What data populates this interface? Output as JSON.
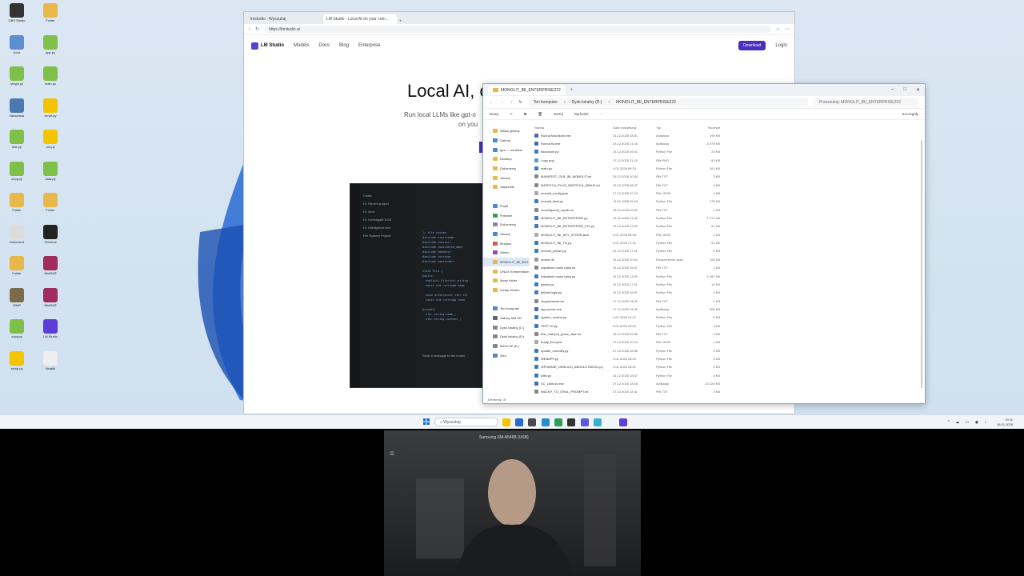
{
  "desktop": {
    "icons": [
      {
        "label": "OBS Studio",
        "color": "#333333"
      },
      {
        "label": "Folder",
        "color": "#e8b84a"
      },
      {
        "label": "Kosz",
        "color": "#5c8fd0"
      },
      {
        "label": "app.py",
        "color": "#7fc04a"
      },
      {
        "label": "skrypt.py",
        "color": "#7fc04a"
      },
      {
        "label": "main.py",
        "color": "#7fc04a"
      },
      {
        "label": "Narzędzia",
        "color": "#4a7ab0"
      },
      {
        "label": "script.py",
        "color": "#f4c400"
      },
      {
        "label": "test.py",
        "color": "#7fc04a"
      },
      {
        "label": "run.py",
        "color": "#f4c400"
      },
      {
        "label": "copy.py",
        "color": "#7fc04a"
      },
      {
        "label": "data.py",
        "color": "#7fc04a"
      },
      {
        "label": "Folder",
        "color": "#e8b84a"
      },
      {
        "label": "Folder",
        "color": "#e8b84a"
      },
      {
        "label": "Dokument",
        "color": "#dddddd"
      },
      {
        "label": "Terminal",
        "color": "#222222"
      },
      {
        "label": "Folder",
        "color": "#e8b84a"
      },
      {
        "label": "WinRAR",
        "color": "#a02c5c"
      },
      {
        "label": "GIMP",
        "color": "#7a6a4a"
      },
      {
        "label": "WinRAR",
        "color": "#a02c5c"
      },
      {
        "label": "copy.py",
        "color": "#7fc04a"
      },
      {
        "label": "LM Studio",
        "color": "#5b3fd6"
      },
      {
        "label": "setup.py",
        "color": "#f4c400"
      },
      {
        "label": "Notatki",
        "color": "#eeeeee"
      }
    ]
  },
  "browser": {
    "tabs": [
      "lmstudio - Wyszukaj",
      "LM Studio - Local AI on your com..."
    ],
    "url": "https://lmstudio.ai",
    "nav": {
      "brand": "LM Studio",
      "links": [
        "Models",
        "Docs",
        "Blog",
        "Enterprise"
      ],
      "download": "Download",
      "login": "Login"
    },
    "hero": {
      "title": "Local AI, o",
      "subtitle": "Run local LLMs like gpt-o",
      "subtitle2": "on you"
    }
  },
  "lmapp": {
    "items": [
      "Chats",
      "Dr. Recent project",
      "Dr. Aero",
      "Dr. Investigate DOS",
      "Dr. Intelligence test",
      "File System Project"
    ],
    "code": "// file system\n#include <iostream>\n#include <vector>\n#include <unordered_map>\n#include <memory>\n#include <string>\n#include <optional>\n\nclass File {\npublic:\n  explicit File(std::string\n  const std::string& name\n\n  void write(const std::str\n  const std::string& read\n\nprivate:\n  std::string name_;\n  std::string content_;",
    "prompt": "Send a message to the model..."
  },
  "explorer": {
    "tab_title": "MONOLIT_IBI_ENTERPRISE222",
    "breadcrumbs": [
      "Ten komputer",
      "Dysk lokalny (D:)",
      "MONOLIT_IBI_ENTERPRISE222"
    ],
    "search_placeholder": "Przeszukaj: MONOLIT_IBI_ENTERPRISE222",
    "toolbar": {
      "new": "Nowy",
      "sort": "Sortuj",
      "view": "Wyświetl",
      "details": "Szczegóły"
    },
    "sidebar": [
      {
        "label": "Widok główny",
        "color": "#e8b84a"
      },
      {
        "label": "Galeria",
        "color": "#4a8ad0"
      },
      {
        "label": "Igor — osobiste",
        "color": "#4a8ad0"
      },
      {
        "label": "Desktop",
        "color": "#e8b84a"
      },
      {
        "label": "Dokumenty",
        "color": "#e8b84a"
      },
      {
        "label": "Obrazy",
        "color": "#e8b84a"
      },
      {
        "label": "Załączniki",
        "color": "#e8b84a"
      },
      {
        "label": "",
        "color": "#ffffff"
      },
      {
        "label": "Pulpit",
        "color": "#4a8ad0"
      },
      {
        "label": "Pobrane",
        "color": "#3a9a5a"
      },
      {
        "label": "Dokumenty",
        "color": "#8a8aa0"
      },
      {
        "label": "Obrazy",
        "color": "#4a8ad0"
      },
      {
        "label": "Muzyka",
        "color": "#d05a5a"
      },
      {
        "label": "Wideo",
        "color": "#8a4ad0"
      },
      {
        "label": "MONOLIT_IBI_ENT",
        "color": "#e8b84a"
      },
      {
        "label": "LINUX Kompendium",
        "color": "#e8b84a"
      },
      {
        "label": "Nowy folder",
        "color": "#e8b84a"
      },
      {
        "label": "Zrzuty ekranu",
        "color": "#e8b84a"
      },
      {
        "label": "",
        "color": "#ffffff"
      },
      {
        "label": "Ten komputer",
        "color": "#4a8ad0"
      },
      {
        "label": "Galaxy A54 5G",
        "color": "#666666"
      },
      {
        "label": "Dysk lokalny (C:)",
        "color": "#888888"
      },
      {
        "label": "Dysk lokalny (D:)",
        "color": "#888888"
      },
      {
        "label": "BACKUP (E:)",
        "color": "#888888"
      },
      {
        "label": "Sieć",
        "color": "#4a8ad0"
      }
    ],
    "columns": [
      "Nazwa",
      "Data modyfikacji",
      "Typ",
      "Rozmiar"
    ],
    "files": [
      {
        "name": "Runna fokunkoin.exe",
        "date": "21.12.2025 18:51",
        "type": "Aplikacja",
        "size": "190 KB",
        "color": "#4a6ab0"
      },
      {
        "name": "Runna fls.exe",
        "date": "23.12.2025 21:16",
        "type": "Aplikacja",
        "size": "2 575 KB",
        "color": "#4a6ab0"
      },
      {
        "name": "fokunkoin.py",
        "date": "21.12.2025 16:41",
        "type": "Python File",
        "size": "23 KB",
        "color": "#3a7ac0"
      },
      {
        "name": "Logo.png",
        "date": "27.12.2025 21:15",
        "type": "Plik PNG",
        "size": "83 KB",
        "color": "#5a9ad0"
      },
      {
        "name": "main.py",
        "date": "4.01.2026 09:24",
        "type": "Python File",
        "size": "161 KB",
        "color": "#3a7ac0"
      },
      {
        "name": "MANIFEST_GLB_IBI_MONOLIT.txt",
        "date": "26.12.2025 10:34",
        "type": "Plik TXT",
        "size": "3 KB",
        "color": "#888888"
      },
      {
        "name": "MATRYCA_PLUS_MATRYCA_MINUS.txt",
        "date": "28.12.2025 08:37",
        "type": "Plik TXT",
        "size": "4 KB",
        "color": "#888888"
      },
      {
        "name": "monolit_config.json",
        "date": "27.12.2025 07:13",
        "type": "Plik JSON",
        "size": "1 KB",
        "color": "#aaaaaa"
      },
      {
        "name": "monolit_final.py",
        "date": "14.01.2026 09:19",
        "type": "Python File",
        "size": "170 KB",
        "color": "#3a7ac0"
      },
      {
        "name": "monolityczny_wynik.txt",
        "date": "28.12.2025 09:50",
        "type": "Plik TXT",
        "size": "1 KB",
        "color": "#888888"
      },
      {
        "name": "MONOLIT_IBI_ENTERPRISE.py",
        "date": "14.01.2026 21:05",
        "type": "Python File",
        "size": "1 171 KB",
        "color": "#3a7ac0"
      },
      {
        "name": "MONOLIT_IBI_ENTERPRISE_FIX.py",
        "date": "31.12.2025 13:25",
        "type": "Python File",
        "size": "51 KB",
        "color": "#3a7ac0"
      },
      {
        "name": "MONOLIT_IBI_KEY_STORE.json",
        "date": "4.01.2026 09:28",
        "type": "Plik JSON",
        "size": "2 KB",
        "color": "#aaaaaa"
      },
      {
        "name": "MONOLIT_IBI_TO.py",
        "date": "4.01.2026 17:31",
        "type": "Python File",
        "size": "51 KB",
        "color": "#3a7ac0"
      },
      {
        "name": "monolit_parser.py",
        "date": "31.12.2025 17:11",
        "type": "Python File",
        "size": "5 KB",
        "color": "#3a7ac0"
      },
      {
        "name": "ordnet.dll",
        "date": "31.12.2025 10:51",
        "type": "Rozszerzenie aplik...",
        "size": "153 KB",
        "color": "#999999"
      },
      {
        "name": "odpalenie nowe cykly.txt",
        "date": "31.12.2025 16:47",
        "type": "Plik TXT",
        "size": "1 KB",
        "color": "#888888"
      },
      {
        "name": "odpalenie nowe cykly.py",
        "date": "31.12.2025 13:29",
        "type": "Python File",
        "size": "4 187 KB",
        "color": "#3a7ac0"
      },
      {
        "name": "parser.py",
        "date": "31.12.2025 17:11",
        "type": "Python File",
        "size": "10 KB",
        "color": "#3a7ac0"
      },
      {
        "name": "pełnial logic.py",
        "date": "31.12.2025 16:57",
        "type": "Python File",
        "size": "4 KB",
        "color": "#3a7ac0"
      },
      {
        "name": "requirements.txt",
        "date": "27.12.2025 18:20",
        "type": "Plik TXT",
        "size": "1 KB",
        "color": "#888888"
      },
      {
        "name": "spy-server.exe",
        "date": "27.12.2025 18:33",
        "type": "Aplikacja",
        "size": "306 KB",
        "color": "#4a6ab0"
      },
      {
        "name": "system_control.py",
        "date": "4.01.2026 14:47",
        "type": "Python File",
        "size": "5 KB",
        "color": "#3a7ac0"
      },
      {
        "name": "TEST 00.py",
        "date": "5.01.2026 10:22",
        "type": "Python File",
        "size": "3 KB",
        "color": "#3a7ac0"
      },
      {
        "name": "test_matryca_przez_ollar.txt",
        "date": "28.12.2025 09:38",
        "type": "Plik TXT",
        "size": "2 KB",
        "color": "#888888"
      },
      {
        "name": "trusty_tool.json",
        "date": "27.12.2025 10:13",
        "type": "Plik JSON",
        "size": "1 KB",
        "color": "#aaaaaa"
      },
      {
        "name": "update_monolity.py",
        "date": "27.12.2025 18:06",
        "type": "Python File",
        "size": "2 KB",
        "color": "#3a7ac0"
      },
      {
        "name": "WEBAPP.py",
        "date": "4.01.2026 18:20",
        "type": "Python File",
        "size": "3 KB",
        "color": "#3a7ac0"
      },
      {
        "name": "WPISANIE_OBSŁUGI_ABSOLUTNEGO.py",
        "date": "4.01.2026 18:51",
        "type": "Python File",
        "size": "4 KB",
        "color": "#3a7ac0"
      },
      {
        "name": "wifiv.py",
        "date": "31.12.2025 18:47",
        "type": "Python File",
        "size": "3 KB",
        "color": "#3a7ac0"
      },
      {
        "name": "XC_cdkit.s4.exe",
        "date": "27.12.2025 18:16",
        "type": "Aplikacja",
        "size": "13 124 KB",
        "color": "#4a6ab0"
      },
      {
        "name": "WAZNY_TO_GRAL_PROMPT.txt",
        "date": "27.12.2025 18:42",
        "type": "Plik TXT",
        "size": "3 KB",
        "color": "#888888"
      }
    ],
    "status": "Elementy: 37"
  },
  "taskbar": {
    "search": "Wyszukaj",
    "apps": [
      "#f4c400",
      "#2a6ad0",
      "#4a4a4a",
      "#2a8ad0",
      "#2aa05a",
      "#333333",
      "#5a5adf",
      "#3ab0d0",
      "#5b3fd6"
    ],
    "time": "19:11",
    "date": "18.01.2026"
  },
  "webcam": {
    "label": "Samsung SM-A546B (USB)"
  }
}
